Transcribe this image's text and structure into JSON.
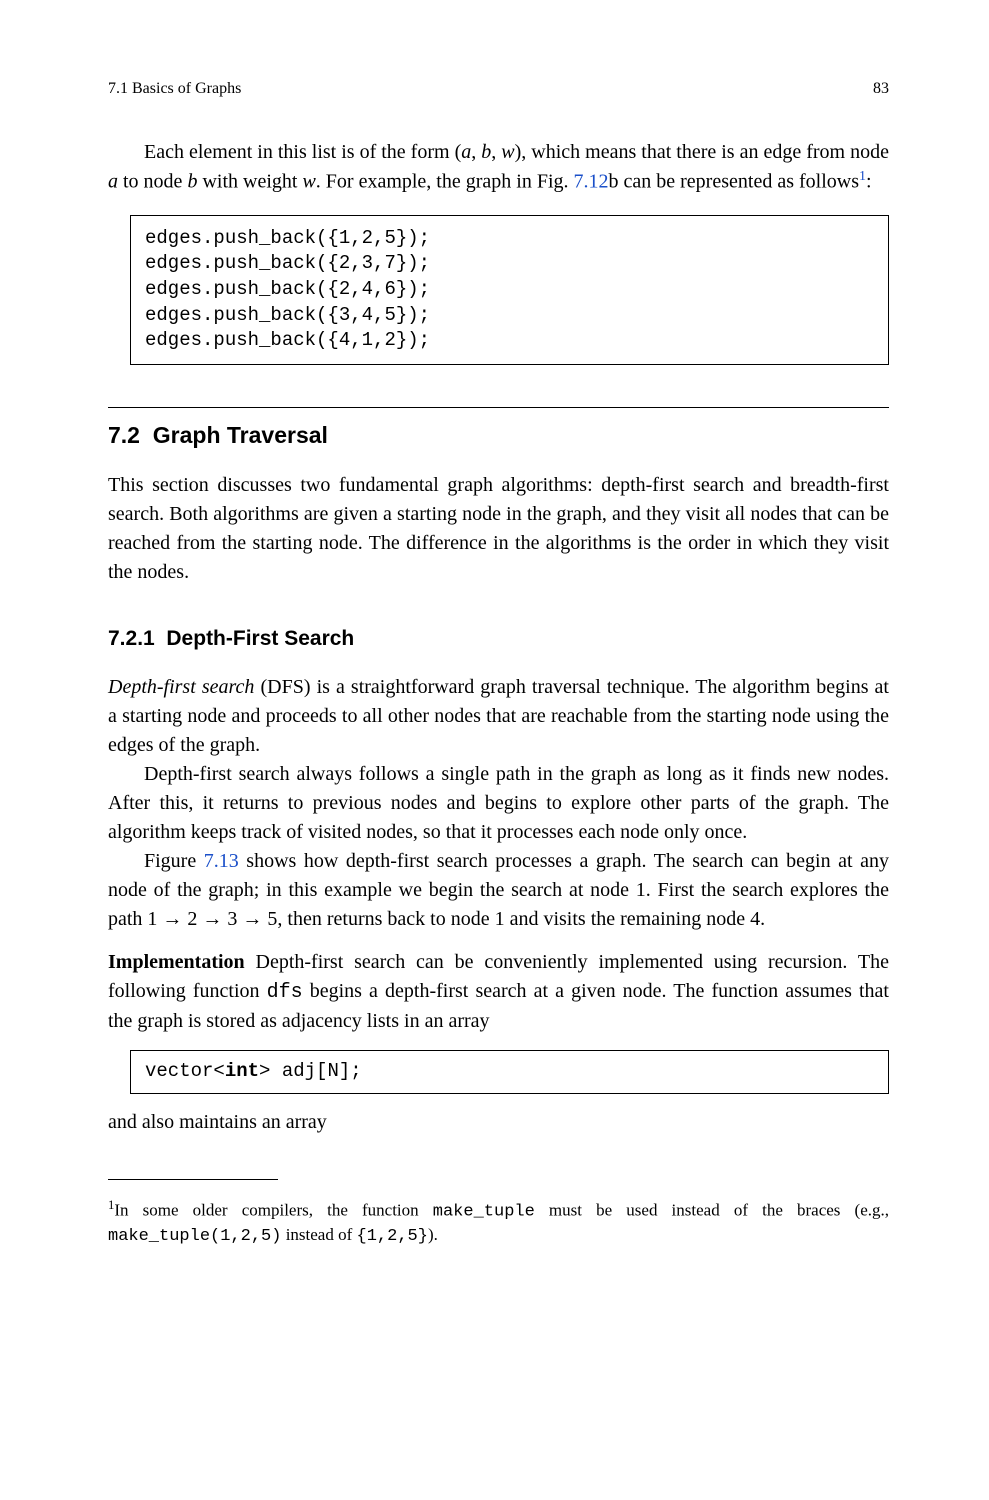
{
  "header": {
    "section_label": "7.1  Basics of Graphs",
    "page_number": "83"
  },
  "intro": {
    "before_ref": "Each element in this list is of the form (",
    "tuple_a": "a",
    "tuple_b": "b",
    "tuple_w": "w",
    "after_tuple": "), which means that there is an edge from node ",
    "a2": "a",
    "mid1": " to node ",
    "b2": "b",
    "mid2": " with weight ",
    "w2": "w",
    "mid3": ". For example, the graph in Fig. ",
    "fig_ref": "7.12",
    "after_ref": "b can be represented as follows",
    "sup": "1",
    "colon": ":"
  },
  "codebox1": "edges.push_back({1,2,5});\nedges.push_back({2,3,7});\nedges.push_back({2,4,6});\nedges.push_back({3,4,5});\nedges.push_back({4,1,2});",
  "section": {
    "number": "7.2",
    "title": "Graph Traversal",
    "body": "This section discusses two fundamental graph algorithms: depth-first search and breadth-first search. Both algorithms are given a starting node in the graph, and they visit all nodes that can be reached from the starting node. The difference in the algorithms is the order in which they visit the nodes."
  },
  "subsection": {
    "number": "7.2.1",
    "title": "Depth-First Search",
    "p1_em": "Depth-first search",
    "p1_rest": " (DFS) is a straightforward graph traversal technique. The algorithm begins at a starting node and proceeds to all other nodes that are reachable from the starting node using the edges of the graph.",
    "p2": "Depth-first search always follows a single path in the graph as long as it finds new nodes. After this, it returns to previous nodes and begins to explore other parts of the graph. The algorithm keeps track of visited nodes, so that it processes each node only once.",
    "p3_before": "Figure ",
    "p3_ref": "7.13",
    "p3_after": " shows how depth-first search processes a graph. The search can begin at any node of the graph; in this example we begin the search at node 1. First the search explores the path 1 → 2 → 3 → 5, then returns back to node 1 and visits the remaining node 4.",
    "impl_label": "Implementation",
    "impl_body_before": " Depth-first search can be conveniently implemented using recursion. The following function ",
    "impl_code": "dfs",
    "impl_body_after": " begins a depth-first search at a given node. The function assumes that the graph is stored as adjacency lists in an array"
  },
  "codebox2_prefix": "vector<",
  "codebox2_kw": "int",
  "codebox2_suffix": "> adj[N];",
  "tail": "and also maintains an array",
  "footnote": {
    "mark": "1",
    "t1": "In some older compilers, the function ",
    "c1": "make_tuple",
    "t2": " must be used instead of the braces (e.g., ",
    "c2": "make_tuple(1,2,5)",
    "t3": " instead of ",
    "c3": "{1,2,5}",
    "t4": ")."
  }
}
